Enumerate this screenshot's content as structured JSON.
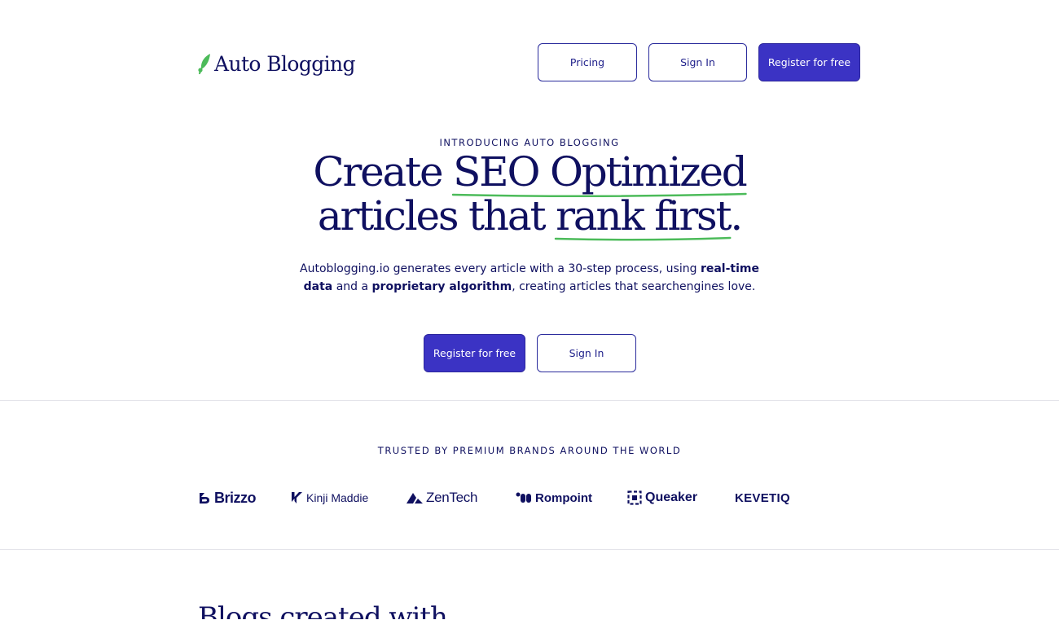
{
  "nav": {
    "logo_text": "Auto Blogging",
    "pricing_label": "Pricing",
    "signin_label": "Sign In",
    "register_label": "Register for free"
  },
  "hero": {
    "eyebrow": "INTRODUCING AUTO BLOGGING",
    "headline_line1_a": "Create ",
    "headline_line1_highlight": "SEO Optimized",
    "headline_line2_a": "articles that ",
    "headline_line2_highlight": "rank first",
    "headline_line2_end": ".",
    "sub_part1": "Autoblogging.io generates every article with a 30-step process, using ",
    "sub_bold1": "real-time data",
    "sub_part2": " and a ",
    "sub_bold2": "proprietary algorithm",
    "sub_part3": ", creating articles that searchengines love.",
    "cta_register_label": "Register for free",
    "cta_signin_label": "Sign In"
  },
  "trusted": {
    "heading": "TRUSTED BY PREMIUM BRANDS AROUND THE WORLD",
    "brands": [
      "Brizzo",
      "Kinji Maddie",
      "ZenTech",
      "Rompoint",
      "Queaker",
      "KEVETIQ"
    ]
  },
  "blogs": {
    "heading": "Blogs created with"
  },
  "colors": {
    "navy": "#0f1060",
    "primary": "#3b33c4",
    "accent_green": "#4cbb5a",
    "border": "#2a2b9c"
  }
}
